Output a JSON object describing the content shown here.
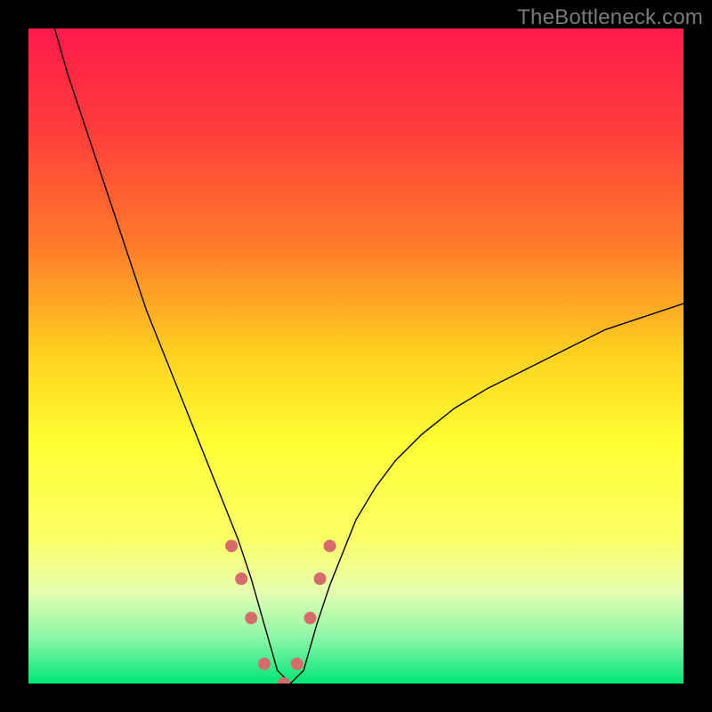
{
  "watermark": "TheBottleneck.com",
  "chart_data": {
    "type": "line",
    "title": "",
    "xlabel": "",
    "ylabel": "",
    "xlim": [
      0,
      100
    ],
    "ylim": [
      0,
      100
    ],
    "grid": false,
    "optimum_range": [
      34,
      42
    ],
    "gradient_stops": [
      {
        "offset": 0.0,
        "color": "#ff1a4d"
      },
      {
        "offset": 0.15,
        "color": "#ff3b3b"
      },
      {
        "offset": 0.33,
        "color": "#ff7a2a"
      },
      {
        "offset": 0.5,
        "color": "#ffd21f"
      },
      {
        "offset": 0.63,
        "color": "#ffff33"
      },
      {
        "offset": 0.78,
        "color": "#fbff66"
      },
      {
        "offset": 0.86,
        "color": "#e5ffb0"
      },
      {
        "offset": 0.93,
        "color": "#8cf7a8"
      },
      {
        "offset": 1.0,
        "color": "#00e676"
      }
    ],
    "series": [
      {
        "name": "curve",
        "stroke": "#000000",
        "stroke_width": 1.4,
        "x": [
          4,
          6,
          8,
          10,
          12,
          14,
          16,
          18,
          20,
          22,
          24,
          26,
          28,
          30,
          32,
          34,
          36,
          38,
          40,
          42,
          44,
          46,
          48,
          50,
          53,
          56,
          60,
          65,
          70,
          76,
          82,
          88,
          94,
          100
        ],
        "values": [
          100,
          93,
          87,
          81,
          75,
          69,
          63,
          57,
          52,
          47,
          42,
          37,
          32,
          27,
          22,
          16,
          9,
          2,
          0,
          2,
          9,
          15,
          20,
          25,
          30,
          34,
          38,
          42,
          45,
          48,
          51,
          54,
          56,
          58
        ]
      },
      {
        "name": "markers",
        "type": "scatter",
        "color": "#d76a6a",
        "radius": 7,
        "x": [
          31,
          32.5,
          34,
          36,
          39,
          41,
          43,
          44.5,
          46
        ],
        "values": [
          21,
          16,
          10,
          3,
          0,
          3,
          10,
          16,
          21
        ]
      }
    ]
  }
}
